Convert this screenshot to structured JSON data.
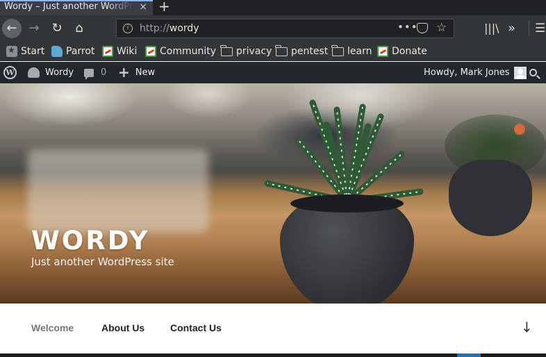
{
  "browser": {
    "tab_title": "Wordy – Just another WordPress site",
    "tab_close": "×",
    "new_tab": "+",
    "url_protocol": "http://",
    "url_host": "wordy",
    "url_dots": "•••",
    "bookmarks": [
      {
        "label": "Start",
        "icon": "start-icon"
      },
      {
        "label": "Parrot",
        "icon": "parrot-icon"
      },
      {
        "label": "Wiki",
        "icon": "kali-icon"
      },
      {
        "label": "Community",
        "icon": "kali-icon"
      },
      {
        "label": "privacy",
        "icon": "folder-icon"
      },
      {
        "label": "pentest",
        "icon": "folder-icon"
      },
      {
        "label": "learn",
        "icon": "folder-icon"
      },
      {
        "label": "Donate",
        "icon": "kali-icon"
      }
    ]
  },
  "adminbar": {
    "site_name": "Wordy",
    "comments_count": "0",
    "new_label": "New",
    "greeting": "Howdy, Mark Jones"
  },
  "site": {
    "title": "WORDY",
    "tagline": "Just another WordPress site",
    "menu": [
      "Welcome",
      "About Us",
      "Contact Us"
    ]
  }
}
